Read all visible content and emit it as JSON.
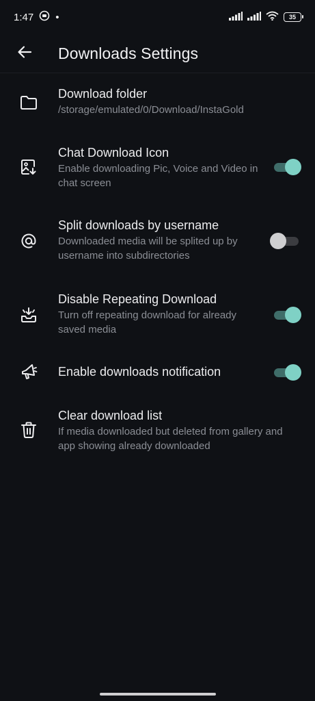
{
  "status_bar": {
    "time": "1:47",
    "dot": "•",
    "battery": "35"
  },
  "header": {
    "title": "Downloads Settings"
  },
  "settings": [
    {
      "title": "Download folder",
      "subtitle": "/storage/emulated/0/Download/InstaGold",
      "icon": "folder-icon"
    },
    {
      "title": "Chat Download Icon",
      "subtitle": "Enable downloading Pic, Voice and Video in chat screen",
      "icon": "image-download-icon",
      "toggle": "on"
    },
    {
      "title": "Split downloads by username",
      "subtitle": "Downloaded media will be splited up by username into subdirectories",
      "icon": "at-sign-icon",
      "toggle": "off"
    },
    {
      "title": "Disable Repeating Download",
      "subtitle": "Turn off repeating download for already saved media",
      "icon": "tray-download-icon",
      "toggle": "on"
    },
    {
      "title": "Enable downloads notification",
      "icon": "megaphone-icon",
      "toggle": "on"
    },
    {
      "title": "Clear download list",
      "subtitle": "If media downloaded but deleted from gallery and app showing already downloaded",
      "icon": "trash-icon"
    }
  ],
  "colors": {
    "background": "#0f1115",
    "toggle_on_thumb": "#7fd1c5",
    "toggle_on_track": "#3f6d69",
    "toggle_off_thumb": "#cfcfd1",
    "toggle_off_track": "#3b3c40"
  }
}
